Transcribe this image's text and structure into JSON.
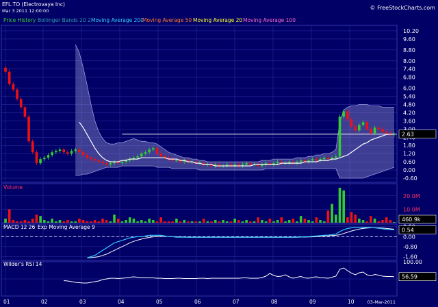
{
  "header": {
    "symbol": "EFL.TO (Electrovaya Inc)",
    "datetime": "Mar 3 2011 12:00:00",
    "watermark": "© FreeStockCharts.com"
  },
  "legend": [
    {
      "label": "Price History",
      "color": "#33cc33"
    },
    {
      "label": "Bollinger Bands 20 2",
      "color": "#3399aa"
    },
    {
      "label": "Moving Average 200",
      "color": "#33ccff"
    },
    {
      "label": "Moving Average 50",
      "color": "#ff7733"
    },
    {
      "label": "Moving Average 20",
      "color": "#ffff33"
    },
    {
      "label": "Moving Average 100",
      "color": "#ff66cc"
    }
  ],
  "panels": {
    "volume": {
      "title": "Volume"
    },
    "macd": {
      "title_a": "MACD 12 26",
      "title_b": "Exp Moving Average 9"
    },
    "rsi": {
      "title": "Wilder's RSI 14"
    }
  },
  "xaxis": {
    "labels": [
      "01",
      "02",
      "03",
      "04",
      "05",
      "06",
      "07",
      "08",
      "09",
      "10",
      "03-Mar-2011"
    ]
  },
  "colors": {
    "up": "#33cc33",
    "down": "#ee1111",
    "background": "#000066",
    "grid": "#3333aa",
    "text": "#ffffff"
  },
  "chart_data": [
    {
      "type": "candlestick",
      "panel": "price",
      "ylim": [
        -0.9,
        10.6
      ],
      "yticks": [
        "10.20",
        "9.60",
        "8.80",
        "8.00",
        "7.40",
        "6.80",
        "6.00",
        "5.40",
        "4.80",
        "4.20",
        "3.60",
        "3.00",
        "2.40",
        "1.80",
        "1.20",
        "0.60",
        "0.00",
        "-0.60"
      ],
      "last_price": "2.63",
      "x": [
        "01",
        "02",
        "03",
        "04",
        "05",
        "06",
        "07",
        "08",
        "09",
        "10"
      ],
      "closes": [
        7.2,
        6.3,
        5.9,
        5.2,
        4.6,
        3.9,
        2.1,
        1.3,
        0.5,
        0.8,
        0.9,
        1.1,
        1.3,
        1.4,
        1.5,
        1.3,
        1.2,
        1.4,
        1.5,
        1.3,
        1.1,
        0.9,
        0.8,
        0.7,
        0.6,
        0.5,
        0.4,
        0.5,
        0.6,
        0.5,
        0.6,
        0.7,
        0.8,
        0.9,
        1.0,
        1.2,
        1.3,
        1.5,
        1.6,
        1.2,
        1.0,
        0.9,
        0.8,
        0.7,
        0.7,
        0.6,
        0.7,
        0.6,
        0.6,
        0.5,
        0.5,
        0.4,
        0.4,
        0.3,
        0.4,
        0.3,
        0.3,
        0.4,
        0.3,
        0.4,
        0.3,
        0.4,
        0.5,
        0.4,
        0.4,
        0.3,
        0.4,
        0.5,
        0.4,
        0.5,
        0.6,
        0.5,
        0.5,
        0.6,
        0.5,
        0.6,
        0.7,
        0.6,
        0.7,
        0.8,
        0.7,
        0.8,
        0.9,
        0.8,
        0.9,
        1.0,
        3.9,
        4.3,
        3.7,
        3.2,
        2.9,
        3.3,
        3.5,
        3.0,
        2.7,
        3.1,
        3.0,
        2.8,
        2.7,
        2.6,
        2.63
      ],
      "ma200": [
        null,
        null,
        null,
        null,
        null,
        null,
        null,
        null,
        null,
        null,
        null,
        null,
        null,
        null,
        null,
        null,
        null,
        null,
        null,
        3.5,
        3.1,
        2.6,
        2.1,
        1.6,
        1.2,
        0.9,
        0.7,
        0.6,
        0.6,
        0.6,
        0.7,
        0.7,
        0.8,
        0.8,
        0.8,
        0.9,
        0.9,
        0.9,
        0.9,
        0.9,
        0.9,
        0.9,
        0.8,
        0.8,
        0.8,
        0.7,
        0.7,
        0.6,
        0.6,
        0.5,
        0.5,
        0.4,
        0.4,
        0.4,
        0.3,
        0.3,
        0.3,
        0.3,
        0.3,
        0.3,
        0.3,
        0.3,
        0.3,
        0.3,
        0.4,
        0.4,
        0.4,
        0.4,
        0.4,
        0.4,
        0.4,
        0.5,
        0.5,
        0.5,
        0.5,
        0.5,
        0.5,
        0.6,
        0.6,
        0.6,
        0.6,
        0.7,
        0.7,
        0.7,
        0.8,
        0.8,
        0.9,
        1.0,
        1.1,
        1.3,
        1.5,
        1.7,
        1.9,
        2.0,
        2.2,
        2.3,
        2.4,
        2.5,
        2.6,
        2.62,
        2.63
      ],
      "hline": 2.63,
      "bollinger_upper": [
        null,
        null,
        null,
        null,
        null,
        null,
        null,
        null,
        null,
        null,
        null,
        null,
        null,
        null,
        null,
        null,
        null,
        null,
        9.2,
        8.6,
        7.5,
        6.2,
        4.8,
        3.6,
        2.8,
        2.3,
        2.0,
        1.9,
        1.9,
        2.0,
        2.0,
        2.1,
        2.2,
        2.3,
        2.2,
        2.1,
        2.1,
        2.0,
        2.0,
        1.9,
        1.7,
        1.5,
        1.3,
        1.2,
        1.1,
        1.0,
        0.9,
        0.9,
        0.8,
        0.8,
        0.7,
        0.7,
        0.6,
        0.6,
        0.6,
        0.6,
        0.6,
        0.6,
        0.6,
        0.6,
        0.6,
        0.6,
        0.6,
        0.6,
        0.6,
        0.6,
        0.7,
        0.7,
        0.7,
        0.8,
        0.8,
        0.8,
        0.8,
        0.8,
        0.8,
        0.9,
        0.9,
        0.9,
        1.0,
        1.0,
        1.1,
        1.1,
        1.2,
        1.2,
        1.3,
        1.5,
        3.5,
        4.4,
        4.6,
        4.7,
        4.7,
        4.8,
        4.8,
        4.8,
        4.7,
        4.7,
        4.7,
        4.6,
        4.6,
        4.6,
        4.6
      ],
      "bollinger_lower": [
        null,
        null,
        null,
        null,
        null,
        null,
        null,
        null,
        null,
        null,
        null,
        null,
        null,
        null,
        null,
        null,
        null,
        null,
        -0.4,
        -0.4,
        -0.3,
        -0.3,
        -0.2,
        -0.1,
        0.0,
        0.1,
        0.2,
        0.2,
        0.2,
        0.2,
        0.3,
        0.3,
        0.3,
        0.3,
        0.3,
        0.3,
        0.3,
        0.3,
        0.3,
        0.2,
        0.2,
        0.2,
        0.2,
        0.1,
        0.1,
        0.1,
        0.1,
        0.1,
        0.1,
        0.1,
        0.0,
        0.0,
        0.0,
        0.0,
        0.0,
        0.0,
        0.0,
        0.0,
        0.0,
        0.0,
        0.0,
        0.0,
        0.0,
        0.0,
        0.0,
        0.0,
        0.0,
        0.1,
        0.1,
        0.1,
        0.1,
        0.1,
        0.1,
        0.1,
        0.1,
        0.1,
        0.1,
        0.1,
        0.1,
        0.1,
        0.1,
        0.1,
        0.1,
        0.1,
        0.1,
        0.1,
        -0.6,
        -0.6,
        -0.6,
        -0.6,
        -0.6,
        -0.6,
        -0.6,
        -0.5,
        -0.4,
        -0.3,
        -0.2,
        -0.1,
        0.0,
        0.1,
        0.2
      ]
    },
    {
      "type": "bar",
      "panel": "volume",
      "yticks": [
        "20.0M",
        "10.0M"
      ],
      "ylim": [
        0,
        26
      ],
      "last_value": "460.9k",
      "values_m": [
        3,
        10,
        2,
        1,
        1,
        2,
        1,
        3,
        6,
        5,
        2,
        1,
        3,
        1,
        2,
        1,
        2,
        1,
        1,
        3,
        2,
        1,
        1,
        2,
        1,
        3,
        2,
        1,
        6,
        3,
        1,
        2,
        4,
        3,
        1,
        2,
        1,
        3,
        2,
        1,
        4,
        1,
        1,
        1,
        3,
        1,
        2,
        1,
        1,
        1,
        1,
        3,
        1,
        1,
        2,
        1,
        2,
        1,
        1,
        3,
        2,
        1,
        2,
        1,
        1,
        4,
        2,
        1,
        3,
        1,
        2,
        4,
        1,
        2,
        3,
        1,
        5,
        3,
        2,
        1,
        4,
        2,
        1,
        9,
        14,
        6,
        26,
        24,
        4,
        8,
        6,
        3,
        2,
        1,
        5,
        3,
        1,
        2,
        4,
        2,
        0.46
      ]
    },
    {
      "type": "line",
      "panel": "macd",
      "yticks": [
        "0.80",
        "0.00",
        "-0.80",
        "-1.60"
      ],
      "ylim": [
        -1.9,
        1.0
      ],
      "last_value": "0.54",
      "macd": [
        null,
        null,
        null,
        null,
        null,
        null,
        null,
        null,
        null,
        null,
        null,
        null,
        null,
        null,
        null,
        null,
        null,
        null,
        null,
        null,
        null,
        -1.7,
        -1.6,
        -1.5,
        -1.3,
        -1.1,
        -0.9,
        -0.7,
        -0.5,
        -0.4,
        -0.3,
        -0.2,
        -0.1,
        -0.05,
        0.0,
        0.0,
        0.05,
        0.1,
        0.1,
        0.1,
        0.1,
        0.05,
        0.0,
        0.0,
        -0.05,
        -0.05,
        -0.05,
        -0.05,
        -0.05,
        -0.05,
        -0.05,
        -0.05,
        -0.05,
        -0.05,
        -0.05,
        -0.05,
        -0.05,
        -0.05,
        -0.05,
        -0.05,
        -0.05,
        -0.05,
        -0.05,
        -0.05,
        -0.05,
        -0.05,
        -0.05,
        -0.05,
        -0.05,
        -0.05,
        -0.05,
        -0.05,
        -0.05,
        -0.05,
        -0.05,
        -0.04,
        -0.03,
        -0.02,
        0.0,
        0.02,
        0.05,
        0.08,
        0.1,
        0.12,
        0.15,
        0.2,
        0.4,
        0.55,
        0.65,
        0.7,
        0.72,
        0.74,
        0.75,
        0.74,
        0.72,
        0.7,
        0.66,
        0.62,
        0.58,
        0.56,
        0.54
      ],
      "signal": [
        null,
        null,
        null,
        null,
        null,
        null,
        null,
        null,
        null,
        null,
        null,
        null,
        null,
        null,
        null,
        null,
        null,
        null,
        null,
        null,
        null,
        -1.7,
        -1.68,
        -1.65,
        -1.6,
        -1.5,
        -1.4,
        -1.25,
        -1.1,
        -0.95,
        -0.8,
        -0.65,
        -0.5,
        -0.38,
        -0.28,
        -0.2,
        -0.12,
        -0.06,
        -0.02,
        0.0,
        0.02,
        0.02,
        0.01,
        0.0,
        -0.02,
        -0.03,
        -0.04,
        -0.05,
        -0.05,
        -0.05,
        -0.05,
        -0.05,
        -0.05,
        -0.05,
        -0.05,
        -0.05,
        -0.05,
        -0.05,
        -0.05,
        -0.05,
        -0.05,
        -0.05,
        -0.05,
        -0.05,
        -0.05,
        -0.05,
        -0.05,
        -0.05,
        -0.05,
        -0.05,
        -0.05,
        -0.05,
        -0.05,
        -0.05,
        -0.05,
        -0.05,
        -0.04,
        -0.04,
        -0.03,
        -0.02,
        0.0,
        0.02,
        0.04,
        0.06,
        0.08,
        0.1,
        0.15,
        0.25,
        0.35,
        0.45,
        0.53,
        0.6,
        0.65,
        0.68,
        0.7,
        0.71,
        0.7,
        0.68,
        0.65,
        0.62,
        0.59
      ]
    },
    {
      "type": "line",
      "panel": "rsi",
      "yticks": [
        "100.00",
        "50.00"
      ],
      "ylim": [
        0,
        100
      ],
      "last_value": "56.59",
      "values": [
        null,
        null,
        null,
        null,
        null,
        null,
        null,
        null,
        null,
        null,
        null,
        null,
        null,
        null,
        null,
        45,
        44,
        42,
        40,
        39,
        38,
        38,
        40,
        42,
        44,
        48,
        50,
        52,
        52,
        51,
        52,
        53,
        55,
        56,
        55,
        54,
        54,
        53,
        53,
        52,
        52,
        51,
        51,
        51,
        52,
        52,
        51,
        51,
        51,
        51,
        52,
        52,
        51,
        52,
        52,
        52,
        52,
        52,
        52,
        52,
        52,
        53,
        53,
        52,
        52,
        52,
        54,
        58,
        66,
        60,
        57,
        58,
        62,
        56,
        52,
        55,
        57,
        53,
        52,
        55,
        56,
        54,
        53,
        52,
        55,
        58,
        78,
        82,
        74,
        67,
        62,
        68,
        70,
        62,
        59,
        63,
        61,
        58,
        57,
        57,
        56.59
      ]
    }
  ]
}
